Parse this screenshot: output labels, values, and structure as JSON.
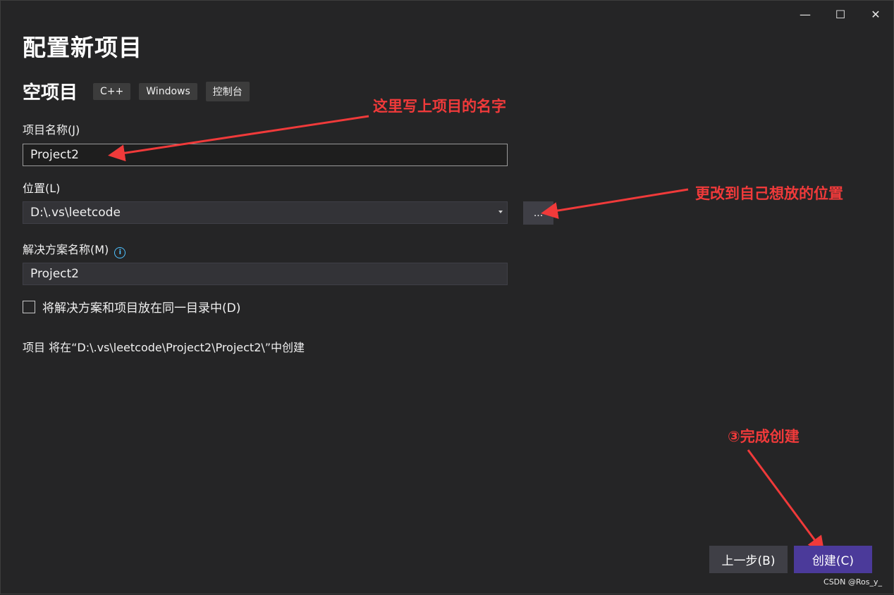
{
  "window": {
    "minimize_label": "—",
    "maximize_label": "☐",
    "close_label": "✕"
  },
  "page_title": "配置新项目",
  "template": {
    "name": "空项目",
    "tags": [
      "C++",
      "Windows",
      "控制台"
    ]
  },
  "form": {
    "project_name_label": "项目名称(J)",
    "project_name_value": "Project2",
    "location_label": "位置(L)",
    "location_value": "D:\\.vs\\leetcode",
    "browse_label": "...",
    "solution_name_label": "解决方案名称(M)",
    "solution_name_value": "Project2",
    "same_dir_checkbox_label": "将解决方案和项目放在同一目录中(D)",
    "same_dir_checked": false,
    "info_icon": "i"
  },
  "path_note": "项目 将在“D:\\.vs\\leetcode\\Project2\\Project2\\”中创建",
  "annotations": {
    "name_hint": "这里写上项目的名字",
    "location_hint": "更改到自己想放的位置",
    "create_hint": "③完成创建",
    "color": "#f03a3a"
  },
  "buttons": {
    "back_label": "上一步(B)",
    "create_label": "创建(C)"
  },
  "watermark": "CSDN @Ros_y_",
  "colors": {
    "background": "#252526",
    "primary_button": "#4b3a9a",
    "secondary_button": "#3f3f46",
    "info_icon": "#4fc1ff"
  }
}
